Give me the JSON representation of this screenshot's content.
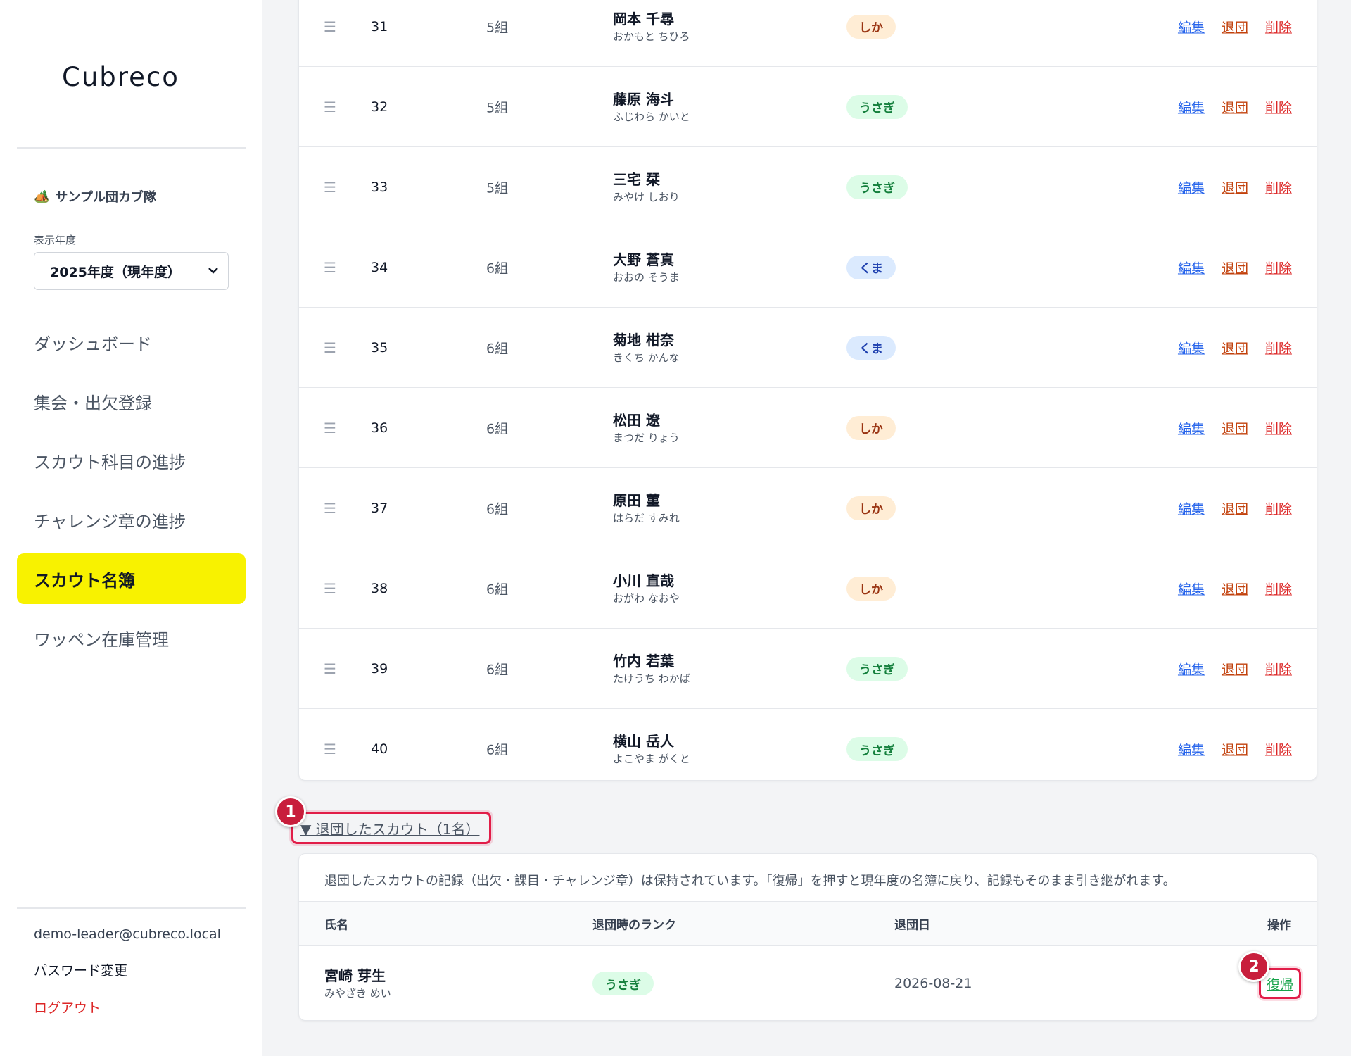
{
  "brand": {
    "logo": "Cubreco"
  },
  "sidebar": {
    "troop_icon": "🏕️",
    "troop_name": "サンプル団カブ隊",
    "year_label": "表示年度",
    "year_value": "2025年度（現年度）",
    "nav": [
      {
        "label": "ダッシュボード",
        "active": false
      },
      {
        "label": "集会・出欠登録",
        "active": false
      },
      {
        "label": "スカウト科目の進捗",
        "active": false
      },
      {
        "label": "チャレンジ章の進捗",
        "active": false
      },
      {
        "label": "スカウト名簿",
        "active": true
      },
      {
        "label": "ワッペン在庫管理",
        "active": false
      }
    ],
    "user_email": "demo-leader@cubreco.local",
    "password_change": "パスワード変更",
    "logout": "ログアウト"
  },
  "colors": {
    "active_nav": "#f8f200",
    "shika_bg": "#ffedd5",
    "shika_fg": "#9a3412",
    "usagi_bg": "#dcfce7",
    "usagi_fg": "#15803d",
    "kuma_bg": "#dbeafe",
    "kuma_fg": "#1e40af",
    "annotation": "#e11d48"
  },
  "roster": {
    "actions": {
      "edit": "編集",
      "leave": "退団",
      "delete": "削除"
    },
    "handle_icon": "☰",
    "rows": [
      {
        "no": "31",
        "group": "5組",
        "name": "岡本 千尋",
        "kana": "おかもと ちひろ",
        "rank": "しか",
        "rank_key": "shika"
      },
      {
        "no": "32",
        "group": "5組",
        "name": "藤原 海斗",
        "kana": "ふじわら かいと",
        "rank": "うさぎ",
        "rank_key": "usagi"
      },
      {
        "no": "33",
        "group": "5組",
        "name": "三宅 栞",
        "kana": "みやけ しおり",
        "rank": "うさぎ",
        "rank_key": "usagi"
      },
      {
        "no": "34",
        "group": "6組",
        "name": "大野 蒼真",
        "kana": "おおの そうま",
        "rank": "くま",
        "rank_key": "kuma"
      },
      {
        "no": "35",
        "group": "6組",
        "name": "菊地 柑奈",
        "kana": "きくち かんな",
        "rank": "くま",
        "rank_key": "kuma"
      },
      {
        "no": "36",
        "group": "6組",
        "name": "松田 遼",
        "kana": "まつだ りょう",
        "rank": "しか",
        "rank_key": "shika"
      },
      {
        "no": "37",
        "group": "6組",
        "name": "原田 菫",
        "kana": "はらだ すみれ",
        "rank": "しか",
        "rank_key": "shika"
      },
      {
        "no": "38",
        "group": "6組",
        "name": "小川 直哉",
        "kana": "おがわ なおや",
        "rank": "しか",
        "rank_key": "shika"
      },
      {
        "no": "39",
        "group": "6組",
        "name": "竹内 若葉",
        "kana": "たけうち わかば",
        "rank": "うさぎ",
        "rank_key": "usagi"
      },
      {
        "no": "40",
        "group": "6組",
        "name": "横山 岳人",
        "kana": "よこやま がくと",
        "rank": "うさぎ",
        "rank_key": "usagi"
      }
    ]
  },
  "withdrawn": {
    "toggle_label": "▼ 退団したスカウト（1名）",
    "note": "退団したスカウトの記録（出欠・課目・チャレンジ章）は保持されています。「復帰」を押すと現年度の名簿に戻り、記録もそのまま引き継がれます。",
    "headers": {
      "name": "氏名",
      "rank": "退団時のランク",
      "date": "退団日",
      "action": "操作"
    },
    "row": {
      "name": "宮崎 芽生",
      "kana": "みやざき めい",
      "rank": "うさぎ",
      "rank_key": "usagi",
      "date": "2026-08-21",
      "action": "復帰"
    }
  },
  "annotations": {
    "marker1": "1",
    "marker2": "2"
  }
}
